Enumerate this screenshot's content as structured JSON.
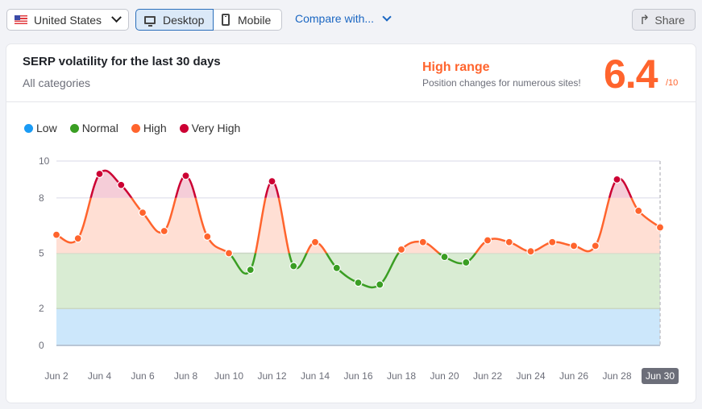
{
  "topbar": {
    "country": "United States",
    "device_tabs": [
      {
        "label": "Desktop",
        "active": true
      },
      {
        "label": "Mobile",
        "active": false
      }
    ],
    "compare_label": "Compare with...",
    "share_label": "Share"
  },
  "card": {
    "title": "SERP volatility for the last 30 days",
    "subtitle": "All categories",
    "range_label": "High range",
    "range_desc": "Position changes for numerous sites!",
    "score": "6.4",
    "score_max": "/10"
  },
  "colors": {
    "low": "#1a9bf5",
    "normal": "#3a9e23",
    "high": "#ff642d",
    "very_high": "#cc0033"
  },
  "chart_data": {
    "type": "line",
    "title": "SERP volatility for the last 30 days",
    "xlabel": "",
    "ylabel": "",
    "ylim": [
      0,
      10
    ],
    "yticks": [
      0,
      2,
      5,
      8,
      10
    ],
    "bands": [
      {
        "name": "Low",
        "from": 0,
        "to": 2
      },
      {
        "name": "Normal",
        "from": 2,
        "to": 5
      },
      {
        "name": "High",
        "from": 5,
        "to": 8
      },
      {
        "name": "Very High",
        "from": 8,
        "to": 10
      }
    ],
    "legend": [
      "Low",
      "Normal",
      "High",
      "Very High"
    ],
    "legend_position": "top-left",
    "x": [
      "Jun 2",
      "Jun 3",
      "Jun 4",
      "Jun 5",
      "Jun 6",
      "Jun 7",
      "Jun 8",
      "Jun 9",
      "Jun 10",
      "Jun 11",
      "Jun 12",
      "Jun 13",
      "Jun 14",
      "Jun 15",
      "Jun 16",
      "Jun 17",
      "Jun 18",
      "Jun 19",
      "Jun 20",
      "Jun 21",
      "Jun 22",
      "Jun 23",
      "Jun 24",
      "Jun 25",
      "Jun 26",
      "Jun 27",
      "Jun 28",
      "Jun 29",
      "Jun 30"
    ],
    "xtick_labels": [
      "Jun 2",
      "Jun 4",
      "Jun 6",
      "Jun 8",
      "Jun 10",
      "Jun 12",
      "Jun 14",
      "Jun 16",
      "Jun 18",
      "Jun 20",
      "Jun 22",
      "Jun 24",
      "Jun 26",
      "Jun 28",
      "Jun 30"
    ],
    "highlighted_x": "Jun 30",
    "series": [
      {
        "name": "Volatility",
        "values": [
          6.0,
          5.8,
          9.3,
          8.7,
          7.2,
          6.2,
          9.2,
          5.9,
          5.0,
          4.1,
          8.9,
          4.3,
          5.6,
          4.2,
          3.4,
          3.3,
          5.2,
          5.6,
          4.8,
          4.5,
          5.7,
          5.6,
          5.1,
          5.6,
          5.4,
          5.4,
          9.0,
          7.3,
          6.4
        ]
      }
    ]
  }
}
